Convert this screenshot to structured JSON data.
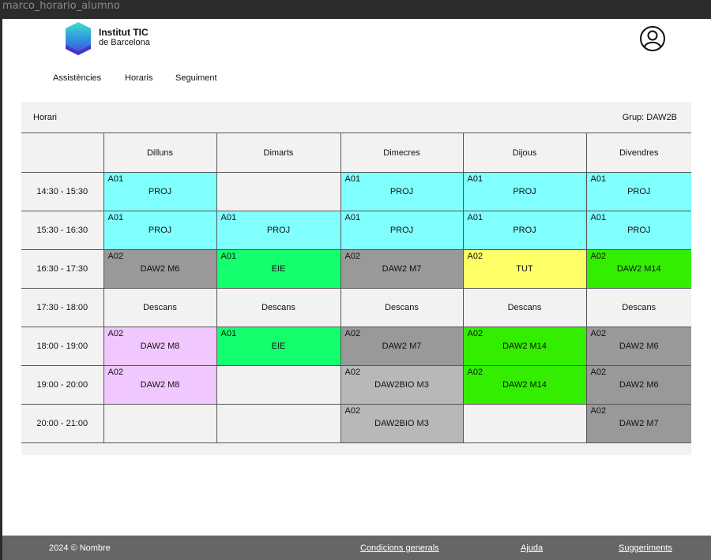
{
  "window_title": "marco_horario_alumno",
  "brand": {
    "line1": "Institut TIC",
    "line2": "de Barcelona"
  },
  "nav": [
    {
      "label": "Assistències"
    },
    {
      "label": "Horaris"
    },
    {
      "label": "Seguiment"
    }
  ],
  "schedule": {
    "title": "Horari",
    "group": "Grup: DAW2B",
    "days": [
      "Dilluns",
      "Dimarts",
      "Dimecres",
      "Dijous",
      "Divendres"
    ],
    "rows": [
      {
        "time": "14:30 - 15:30",
        "cells": [
          {
            "room": "A01",
            "subject": "PROJ",
            "color": "#80ffff"
          },
          {
            "room": "",
            "subject": "",
            "color": "#f2f2f2"
          },
          {
            "room": "A01",
            "subject": "PROJ",
            "color": "#80ffff"
          },
          {
            "room": "A01",
            "subject": "PROJ",
            "color": "#80ffff"
          },
          {
            "room": "A01",
            "subject": "PROJ",
            "color": "#80ffff"
          }
        ]
      },
      {
        "time": "15:30 - 16:30",
        "cells": [
          {
            "room": "A01",
            "subject": "PROJ",
            "color": "#80ffff"
          },
          {
            "room": "A01",
            "subject": "PROJ",
            "color": "#80ffff"
          },
          {
            "room": "A01",
            "subject": "PROJ",
            "color": "#80ffff"
          },
          {
            "room": "A01",
            "subject": "PROJ",
            "color": "#80ffff"
          },
          {
            "room": "A01",
            "subject": "PROJ",
            "color": "#80ffff"
          }
        ]
      },
      {
        "time": "16:30 - 17:30",
        "cells": [
          {
            "room": "A02",
            "subject": "DAW2 M6",
            "color": "#999999"
          },
          {
            "room": "A01",
            "subject": "EIE",
            "color": "#14ff6e"
          },
          {
            "room": "A02",
            "subject": "DAW2 M7",
            "color": "#999999"
          },
          {
            "room": "A02",
            "subject": "TUT",
            "color": "#ffff66"
          },
          {
            "room": "A02",
            "subject": "DAW2 M14",
            "color": "#33ee00"
          }
        ]
      },
      {
        "time": "17:30 - 18:00",
        "cells": [
          {
            "room": "",
            "subject": "Descans",
            "color": "#f2f2f2"
          },
          {
            "room": "",
            "subject": "Descans",
            "color": "#f2f2f2"
          },
          {
            "room": "",
            "subject": "Descans",
            "color": "#f2f2f2"
          },
          {
            "room": "",
            "subject": "Descans",
            "color": "#f2f2f2"
          },
          {
            "room": "",
            "subject": "Descans",
            "color": "#f2f2f2"
          }
        ]
      },
      {
        "time": "18:00 - 19:00",
        "cells": [
          {
            "room": "A02",
            "subject": "DAW2 M8",
            "color": "#f0c8ff"
          },
          {
            "room": "A01",
            "subject": "EIE",
            "color": "#14ff6e"
          },
          {
            "room": "A02",
            "subject": "DAW2 M7",
            "color": "#999999"
          },
          {
            "room": "A02",
            "subject": "DAW2 M14",
            "color": "#33ee00"
          },
          {
            "room": "A02",
            "subject": "DAW2 M6",
            "color": "#999999"
          }
        ]
      },
      {
        "time": "19:00 - 20:00",
        "cells": [
          {
            "room": "A02",
            "subject": "DAW2 M8",
            "color": "#f0c8ff"
          },
          {
            "room": "",
            "subject": "",
            "color": "#f2f2f2"
          },
          {
            "room": "A02",
            "subject": "DAW2BIO M3",
            "color": "#b8b8b8"
          },
          {
            "room": "A02",
            "subject": "DAW2 M14",
            "color": "#33ee00"
          },
          {
            "room": "A02",
            "subject": "DAW2 M6",
            "color": "#999999"
          }
        ]
      },
      {
        "time": "20:00 - 21:00",
        "cells": [
          {
            "room": "",
            "subject": "",
            "color": "#f2f2f2"
          },
          {
            "room": "",
            "subject": "",
            "color": "#f2f2f2"
          },
          {
            "room": "A02",
            "subject": "DAW2BIO M3",
            "color": "#b8b8b8"
          },
          {
            "room": "",
            "subject": "",
            "color": "#f2f2f2"
          },
          {
            "room": "A02",
            "subject": "DAW2 M7",
            "color": "#999999"
          }
        ]
      }
    ]
  },
  "footer": {
    "copyright": "2024 © Nombre",
    "links": [
      "Condicions generals",
      "Ajuda",
      "Suggeriments"
    ]
  }
}
